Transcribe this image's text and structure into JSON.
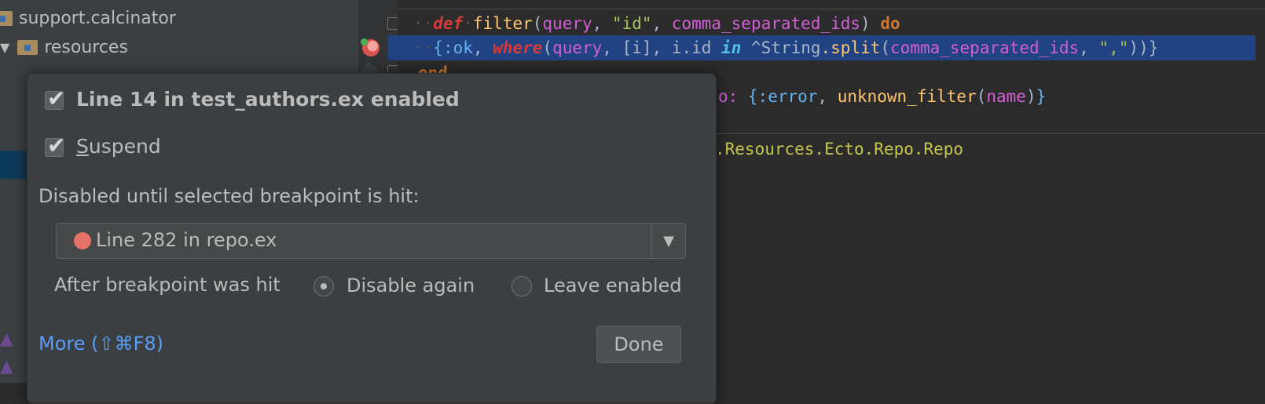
{
  "tree": {
    "items": [
      {
        "label": "support.calcinator",
        "icon": "folder-icon"
      },
      {
        "label": "resources",
        "icon": "resource-folder-icon"
      }
    ]
  },
  "editor": {
    "line1": {
      "def": "def",
      "fn": "filter",
      "open": "(",
      "query": "query",
      "comma1": ", ",
      "id": "\"id\"",
      "comma2": ", ",
      "ids": "comma_separated_ids",
      "close": ")",
      "do": "do"
    },
    "line2": {
      "lb": "{",
      "ok": ":ok",
      "c1": ", ",
      "where": "where",
      "p1": "(",
      "query": "query",
      "c2": ", ",
      "list": "[i]",
      "c3": ", ",
      "iid": "i.id",
      "in": "in",
      "pin": "^",
      "strmod": "String",
      "split": ".split",
      "p2": "(",
      "ids": "comma_separated_ids",
      "c4": ", ",
      "sep": "\",\"",
      "end": "))}"
    },
    "line3": {
      "end": "end"
    },
    "line4": {
      "c1": ", ",
      "do": "do:",
      "lb": "{",
      "err": ":error",
      "c2": ", ",
      "fn": "unknown_filter",
      "p1": "(",
      "name": "name",
      "p2": ")",
      "rb": "}"
    },
    "line5": {
      "mod": ".Resources.Ecto.Repo.Repo"
    }
  },
  "popup": {
    "enabled_label": "Line 14 in test_authors.ex enabled",
    "suspend_mnemonic": "S",
    "suspend_rest": "uspend",
    "disabled_until_label": "Disabled until selected breakpoint is hit:",
    "combo_value": "Line 282 in repo.ex",
    "after_hit_label": "After breakpoint was hit",
    "radio_disable_again": "Disable again",
    "radio_leave_enabled": "Leave enabled",
    "more_link": "More (⇧⌘F8)",
    "done_label": "Done"
  },
  "colors": {
    "accent_link": "#589df6",
    "selection": "#214283",
    "breakpoint": "#e4706a"
  }
}
